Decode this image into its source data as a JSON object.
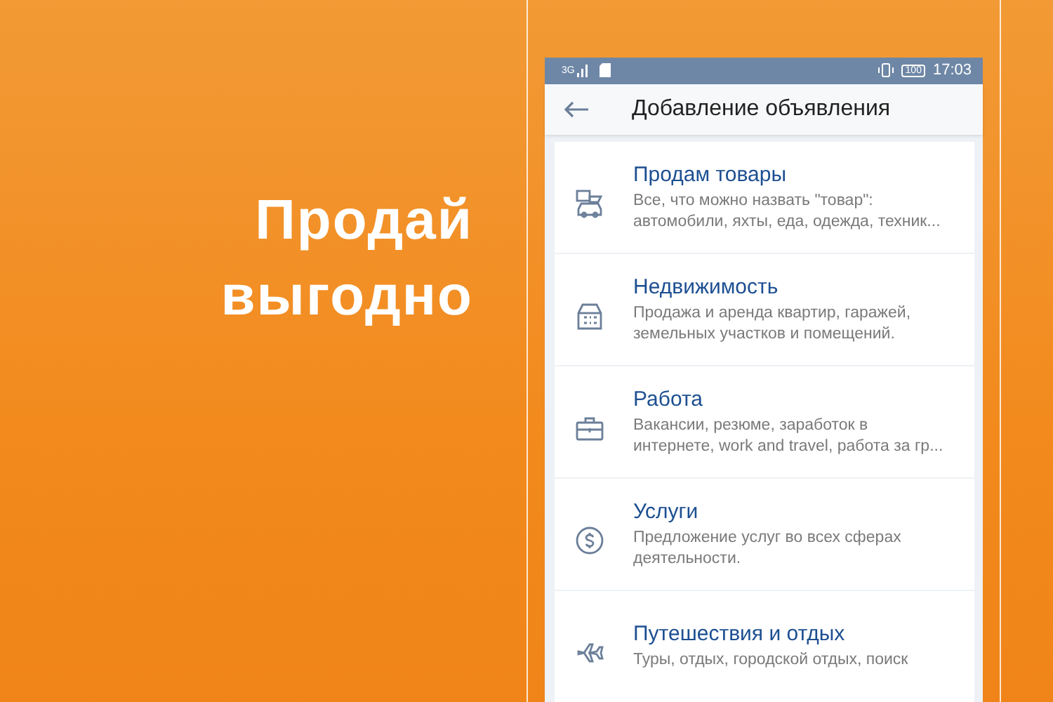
{
  "promo": {
    "headline": "Продай выгодно"
  },
  "status_bar": {
    "network": "3G",
    "battery": "100",
    "time": "17:03"
  },
  "header": {
    "title": "Добавление объявления"
  },
  "categories": [
    {
      "kind": "goods",
      "title": "Продам товары",
      "description": "Все, что можно назвать \"товар\":\nавтомобили, яхты, еда, одежда, техник..."
    },
    {
      "kind": "realty",
      "title": "Недвижимость",
      "description": "Продажа и аренда квартир, гаражей,\nземельных участков и помещений."
    },
    {
      "kind": "job",
      "title": "Работа",
      "description": "Вакансии, резюме, заработок в\nинтернете, work and travel, работа за гр..."
    },
    {
      "kind": "services",
      "title": "Услуги",
      "description": "Предложение услуг во всех сферах\nдеятельности."
    },
    {
      "kind": "travel",
      "title": "Путешествия и отдых",
      "description": "Туры, отдых, городской отдых, поиск"
    }
  ]
}
